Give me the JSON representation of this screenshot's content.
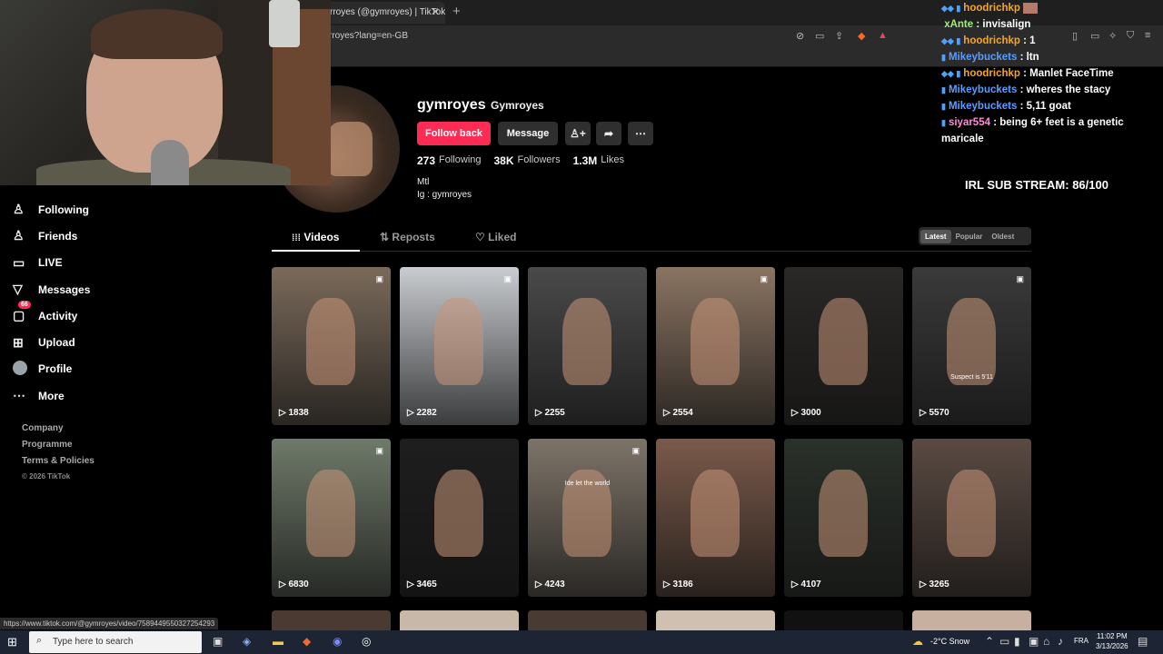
{
  "browser": {
    "tab_title": "rroyes (@gymroyes) | TikTok",
    "tab_close": "✕",
    "new_tab": "+",
    "url": "rroyes?lang=en-GB",
    "status_url": "https://www.tiktok.com/@gymroyes/video/7589449550327254293"
  },
  "sidebar": {
    "items": [
      {
        "label": "Following",
        "icon": "person-icon"
      },
      {
        "label": "Friends",
        "icon": "friends-icon"
      },
      {
        "label": "LIVE",
        "icon": "live-icon"
      },
      {
        "label": "Messages",
        "icon": "messages-icon"
      },
      {
        "label": "Activity",
        "icon": "activity-icon",
        "badge": "66"
      },
      {
        "label": "Upload",
        "icon": "upload-icon"
      },
      {
        "label": "Profile",
        "icon": "avatar"
      },
      {
        "label": "More",
        "icon": "more-icon"
      }
    ],
    "footer": [
      "Company",
      "Programme",
      "Terms & Policies"
    ],
    "copyright": "© 2026 TikTok"
  },
  "profile": {
    "username": "gymroyes",
    "nickname": "Gymroyes",
    "follow_button": "Follow back",
    "message_button": "Message",
    "stats": [
      {
        "value": "273",
        "label": "Following"
      },
      {
        "value": "38K",
        "label": "Followers"
      },
      {
        "value": "1.3M",
        "label": "Likes"
      }
    ],
    "bio_line1": "Mtl",
    "bio_line2": "Ig : gymroyes"
  },
  "content_tabs": {
    "videos": "Videos",
    "reposts": "Reposts",
    "liked": "Liked"
  },
  "sort": [
    "Latest",
    "Popular",
    "Oldest"
  ],
  "videos": [
    {
      "views": "1838",
      "pinned": true,
      "color": "#7a6a5a"
    },
    {
      "views": "2282",
      "pinned": true,
      "color": "#c9ccd0"
    },
    {
      "views": "2255",
      "pinned": false,
      "color": "#4a4a4a"
    },
    {
      "views": "2554",
      "pinned": true,
      "color": "#8a7462"
    },
    {
      "views": "3000",
      "pinned": false,
      "color": "#2a2826"
    },
    {
      "views": "5570",
      "pinned": true,
      "color": "#3a3a3a",
      "caption": "Suspect is 5'11"
    },
    {
      "views": "6830",
      "pinned": true,
      "color": "#6f7a6a"
    },
    {
      "views": "3465",
      "pinned": false,
      "color": "#1e1e1e"
    },
    {
      "views": "4243",
      "pinned": true,
      "color": "#7d7468",
      "caption": "Ide let the world"
    },
    {
      "views": "3186",
      "pinned": false,
      "color": "#7a5a4a"
    },
    {
      "views": "4107",
      "pinned": false,
      "color": "#2a302a"
    },
    {
      "views": "3265",
      "pinned": false,
      "color": "#5a4a42"
    }
  ],
  "chat": [
    {
      "name": "hoodrichkp",
      "text": "",
      "cls": "name-hk",
      "badges": "◆◆ ▮"
    },
    {
      "name": "xAnte",
      "text": " : invisalign",
      "cls": "name-xa",
      "badges": ""
    },
    {
      "name": "hoodrichkp",
      "text": " : 1",
      "cls": "name-hk",
      "badges": "◆◆ ▮"
    },
    {
      "name": "Mikeybuckets",
      "text": " : ltn",
      "cls": "name-mb",
      "badges": "▮"
    },
    {
      "name": "hoodrichkp",
      "text": " : Manlet FaceTime",
      "cls": "name-hk",
      "badges": "◆◆ ▮"
    },
    {
      "name": "Mikeybuckets",
      "text": " : wheres the stacy",
      "cls": "name-mb",
      "badges": "▮"
    },
    {
      "name": "Mikeybuckets",
      "text": " : 5,11 goat",
      "cls": "name-mb",
      "badges": "▮"
    },
    {
      "name": "siyar554",
      "text": " : being 6+ feet is a genetic",
      "cls": "name-si",
      "badges": "▮"
    }
  ],
  "chat_wrap": "maricale",
  "sub_stream": "IRL SUB STREAM: 86/100",
  "taskbar": {
    "search_placeholder": "Type here to search",
    "weather": "-2°C  Snow",
    "lang": "FRA",
    "time": "11:02 PM",
    "date": "3/13/2026"
  }
}
